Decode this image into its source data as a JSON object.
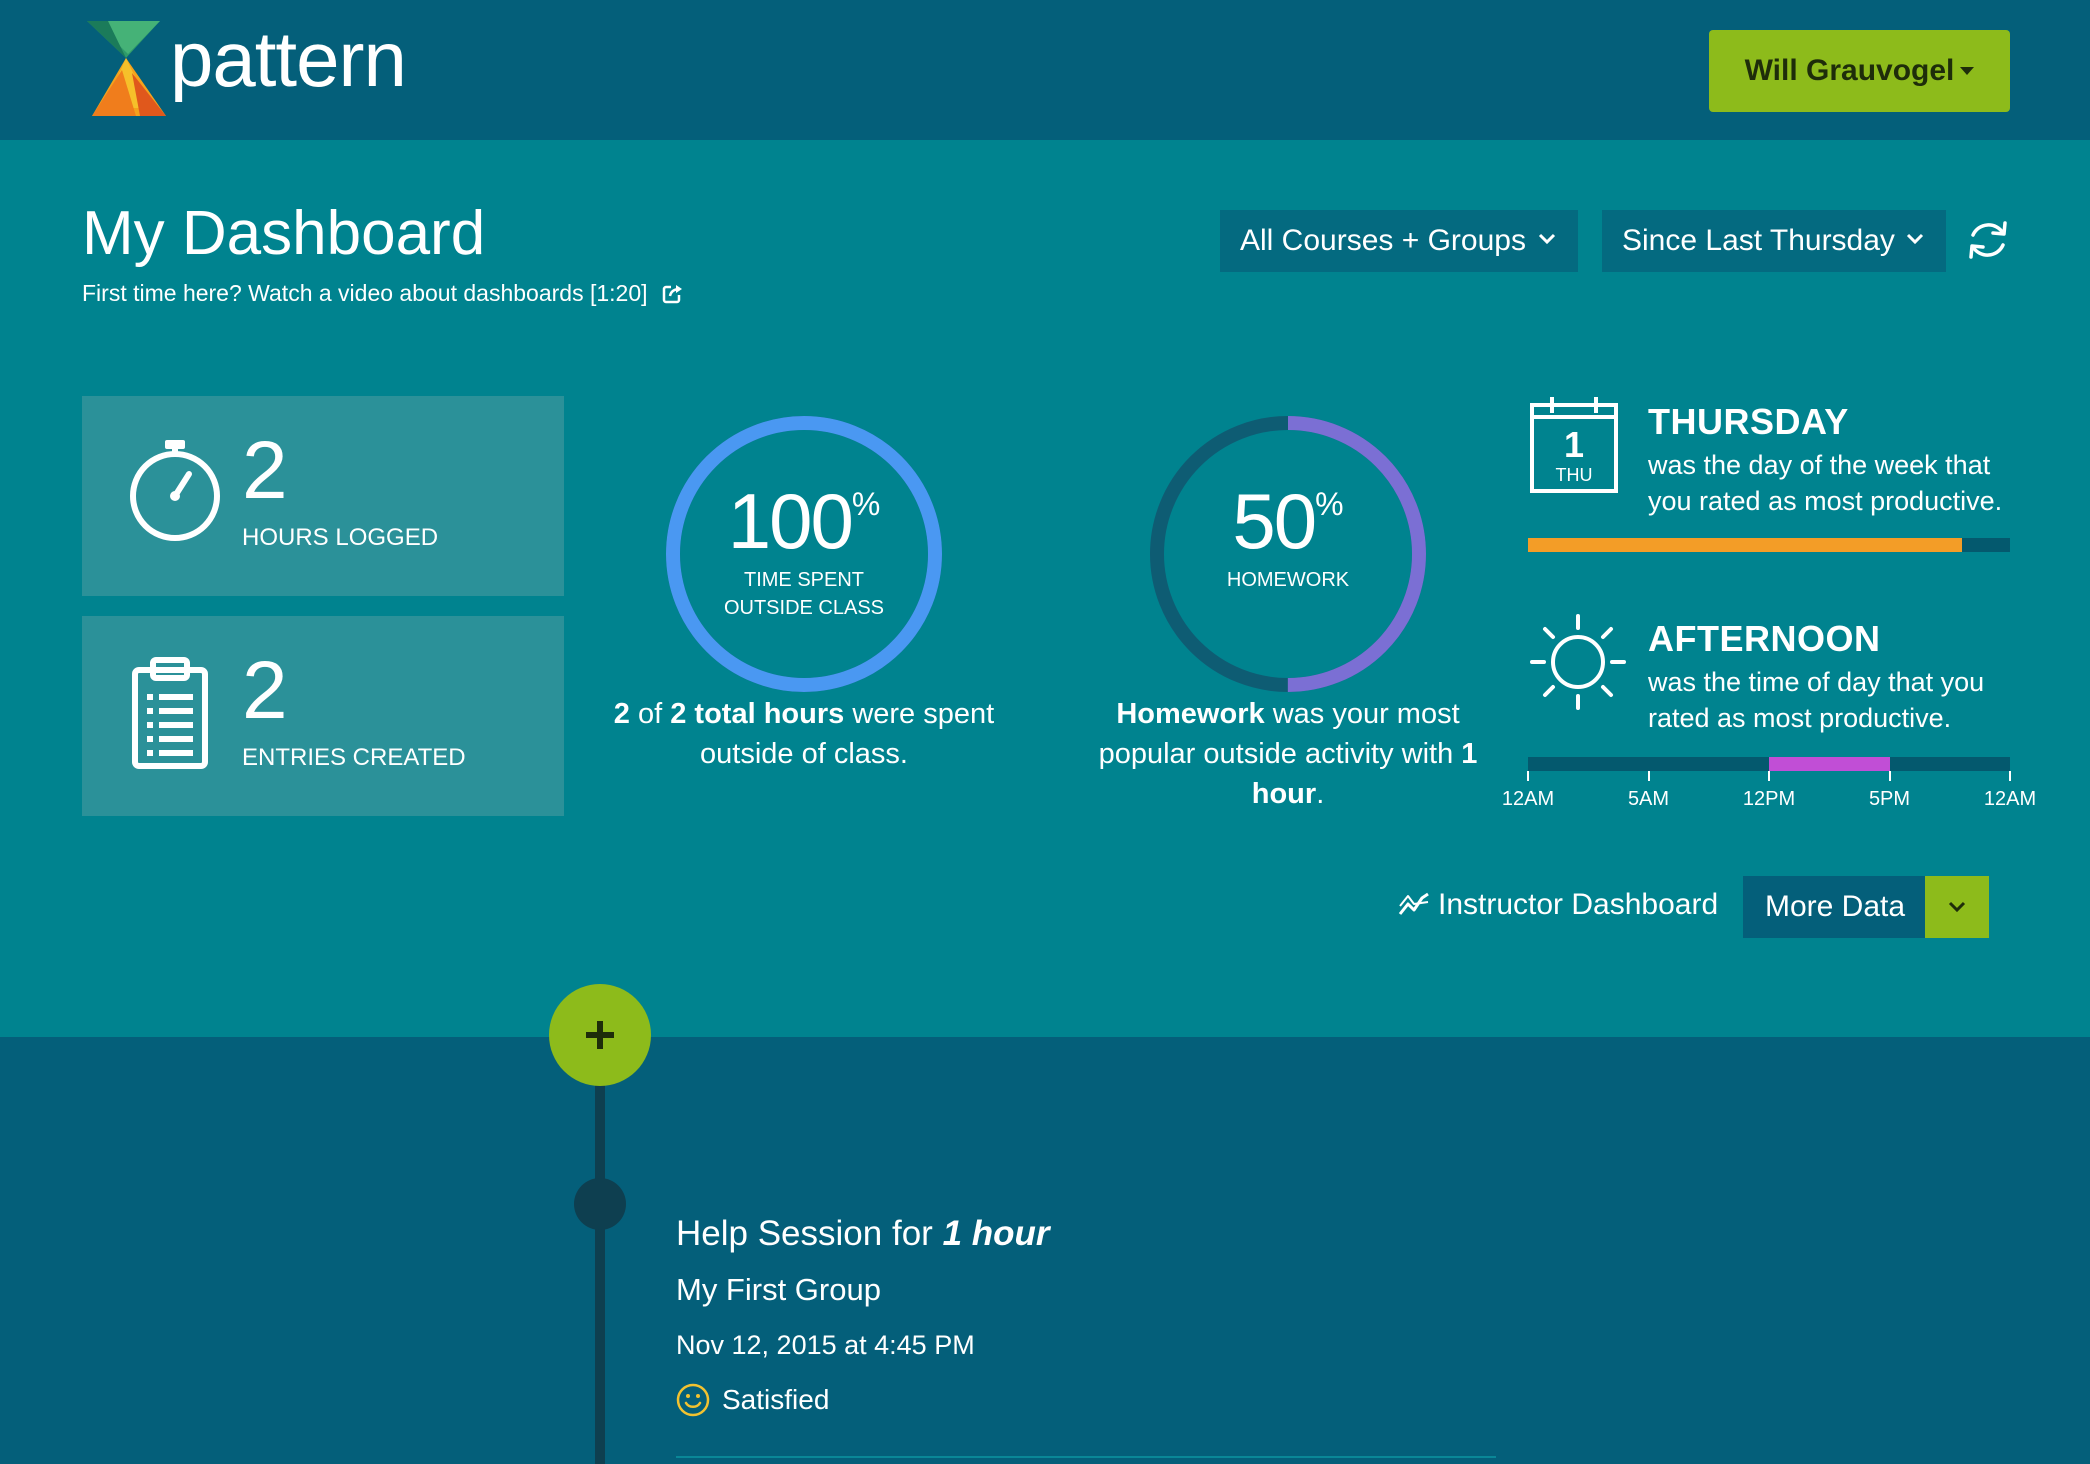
{
  "header": {
    "logo_text": "pattern",
    "user_name": "Will Grauvogel"
  },
  "dashboard": {
    "title": "My Dashboard",
    "subtitle": "First time here? Watch a video about dashboards [1:20]",
    "filters": {
      "courses": "All Courses + Groups",
      "timeframe": "Since Last Thursday"
    }
  },
  "stats": {
    "hours": {
      "value": "2",
      "label": "HOURS LOGGED"
    },
    "entries": {
      "value": "2",
      "label": "ENTRIES CREATED"
    }
  },
  "donut_outside": {
    "value": "100",
    "unit": "%",
    "label_line1": "TIME SPENT",
    "label_line2": "OUTSIDE CLASS",
    "fraction": 1.0,
    "color": "#4a98f2",
    "cap_a": "2",
    "cap_b": "of",
    "cap_c": "2 total hours",
    "cap_d": "were spent outside of class."
  },
  "donut_homework": {
    "value": "50",
    "unit": "%",
    "label": "HOMEWORK",
    "fraction": 0.5,
    "color": "#7b6fd4",
    "cap_a": "Homework",
    "cap_b": "was your most popular outside activity with",
    "cap_c": "1 hour",
    "cap_d": "."
  },
  "productive_day": {
    "calendar_day": "1",
    "calendar_dow": "THU",
    "title": "THURSDAY",
    "description": "was the day of the week that you rated as most productive.",
    "fraction": 0.9,
    "color": "#f39d27"
  },
  "productive_time": {
    "title": "AFTERNOON",
    "description": "was the time of day that you rated as most productive.",
    "range_start_fraction": 0.5,
    "range_end_fraction": 0.75,
    "color": "#c14ed6",
    "ticks": [
      "12AM",
      "5AM",
      "12PM",
      "5PM",
      "12AM"
    ]
  },
  "actions": {
    "instructor_dashboard": "Instructor Dashboard",
    "more_data": "More Data"
  },
  "timeline": {
    "entries": [
      {
        "activity": "Help Session",
        "connector": "for",
        "duration": "1 hour",
        "group": "My First Group",
        "datetime": "Nov 12, 2015 at 4:45 PM",
        "mood": "Satisfied"
      }
    ]
  },
  "colors": {
    "header_bg": "#045f7a",
    "dashboard_bg": "#00838f",
    "accent_green": "#8dbb1b"
  }
}
